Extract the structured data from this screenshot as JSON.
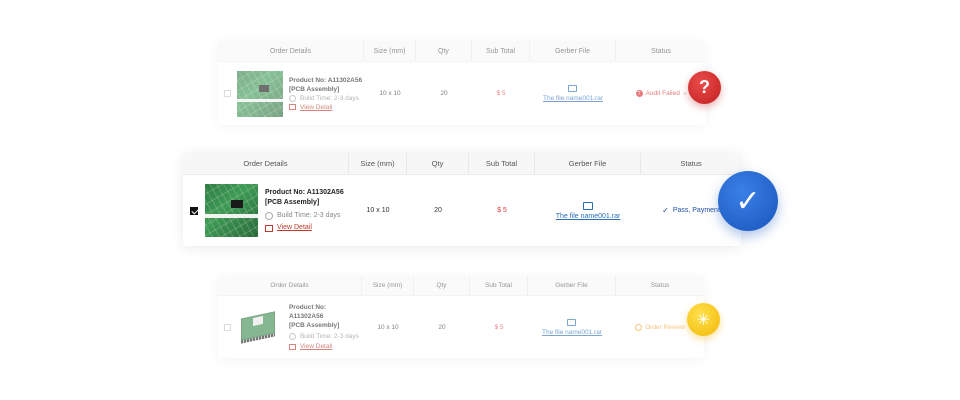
{
  "columns": {
    "order_details": "Order Details",
    "size": "Size (mm)",
    "qty": "Qty",
    "subtotal": "Sub Total",
    "gerber": "Gerber File",
    "status": "Status"
  },
  "orders": [
    {
      "product_no": "Product No: A11302A56",
      "type": "[PCB Assembly]",
      "build_time": "Build Time: 2-3 days",
      "view_detail": "View Detail",
      "size": "10 x 10",
      "qty": "20",
      "subtotal": "$ 5",
      "gerber_file": "The file name001.rar",
      "status": "Audit Failed",
      "status_caret": "∨",
      "checked": false
    },
    {
      "product_no": "Product No: A11302A56",
      "type": "[PCB Assembly]",
      "build_time": "Build Time: 2-3 days",
      "view_detail": "View Detail",
      "size": "10 x 10",
      "qty": "20",
      "subtotal": "$ 5",
      "gerber_file": "The file name001.rar",
      "status": "Pass, Payment",
      "checked": true
    },
    {
      "product_no": "Product No: A11302A56",
      "type": "[PCB Assembly]",
      "build_time": "Build Time: 2-3 days",
      "view_detail": "View Detail",
      "size": "10 x 10",
      "qty": "20",
      "subtotal": "$ 5",
      "gerber_file": "The file name001.rar",
      "status": "Order Review",
      "checked": false
    }
  ],
  "badges": {
    "failed_symbol": "?",
    "pass_symbol": "✓",
    "review_symbol": "✳"
  },
  "colors": {
    "failed": "#d92c2c",
    "pass": "#1f5fc7",
    "review": "#f5c518",
    "price": "#e03a3a",
    "link": "#2a6fb8"
  }
}
